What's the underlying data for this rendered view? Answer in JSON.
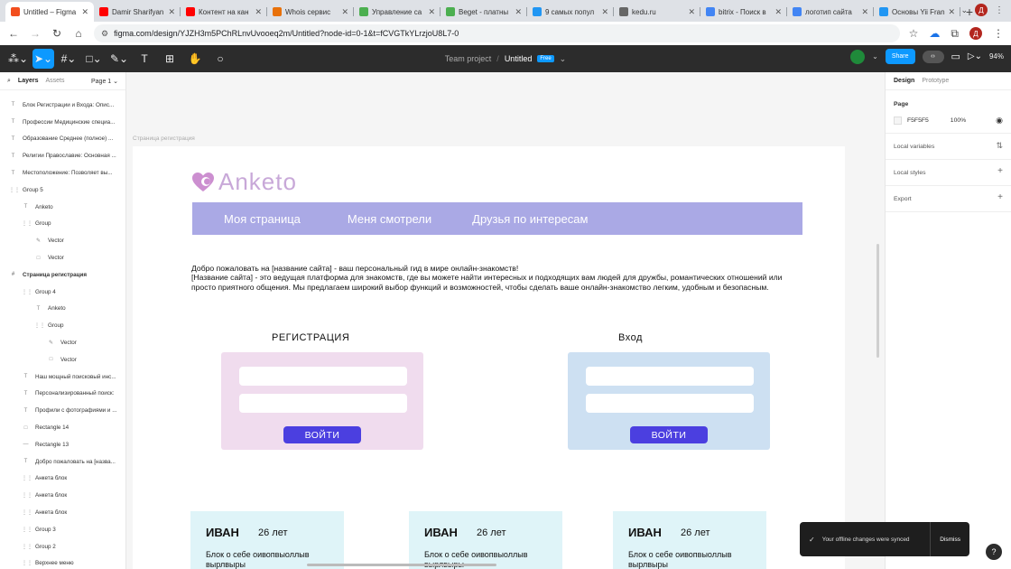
{
  "browser": {
    "tabs": [
      {
        "label": "Untitled – Figma",
        "color": "#f24e1e",
        "active": true
      },
      {
        "label": "Damir Sharifyan",
        "color": "#ff0000"
      },
      {
        "label": "Контент на кан",
        "color": "#ff0000"
      },
      {
        "label": "Whois сервис",
        "color": "#e8710a"
      },
      {
        "label": "Управление са",
        "color": "#4caf50"
      },
      {
        "label": "Beget - платны",
        "color": "#4caf50"
      },
      {
        "label": "9 самых попул",
        "color": "#2196f3"
      },
      {
        "label": "kedu.ru",
        "color": "#666666"
      },
      {
        "label": "bitrix - Поиск в",
        "color": "#4285f4"
      },
      {
        "label": "логотип сайта",
        "color": "#4285f4"
      },
      {
        "label": "Основы Yii Fran",
        "color": "#2196f3"
      }
    ],
    "new_tab": "+",
    "profile_initial": "Д",
    "url": "figma.com/design/YJZH3m5PChRLnvUvooeq2m/Untitled?node-id=0-1&t=fCVGTkYLrzjoU8L7-0"
  },
  "figma_toolbar": {
    "project": "Team project",
    "separator": "/",
    "file": "Untitled",
    "plan_badge": "Free",
    "share": "Share",
    "zoom": "94%"
  },
  "left_panel": {
    "tab_layers": "Layers",
    "tab_assets": "Assets",
    "page": "Page 1",
    "layers": [
      {
        "icon": "T",
        "name": "Блок Регистрации и Входа: Опис...",
        "indent": 0
      },
      {
        "icon": "T",
        "name": "Профессии Медицинские специа...",
        "indent": 0
      },
      {
        "icon": "T",
        "name": "Образование Среднее (полное) ...",
        "indent": 0
      },
      {
        "icon": "T",
        "name": "Религии Православие: Основная ...",
        "indent": 0
      },
      {
        "icon": "T",
        "name": "Местоположение: Позволяет вы...",
        "indent": 0
      },
      {
        "icon": "⋮⋮",
        "name": "Group 5",
        "indent": 0
      },
      {
        "icon": "T",
        "name": "Anketo",
        "indent": 1
      },
      {
        "icon": "⋮⋮",
        "name": "Group",
        "indent": 1
      },
      {
        "icon": "✎",
        "name": "Vector",
        "indent": 2
      },
      {
        "icon": "□",
        "name": "Vector",
        "indent": 2
      },
      {
        "icon": "#",
        "name": "Страница регистрация",
        "indent": 0,
        "bold": true
      },
      {
        "icon": "⋮⋮",
        "name": "Group 4",
        "indent": 1
      },
      {
        "icon": "T",
        "name": "Anketo",
        "indent": 2
      },
      {
        "icon": "⋮⋮",
        "name": "Group",
        "indent": 2
      },
      {
        "icon": "✎",
        "name": "Vector",
        "indent": 3
      },
      {
        "icon": "□",
        "name": "Vector",
        "indent": 3
      },
      {
        "icon": "T",
        "name": "Наш мощный поисковый инс...",
        "indent": 1
      },
      {
        "icon": "T",
        "name": "Персонализированный поиск:",
        "indent": 1
      },
      {
        "icon": "T",
        "name": "Профили с фотографиями и ...",
        "indent": 1
      },
      {
        "icon": "□",
        "name": "Rectangle 14",
        "indent": 1
      },
      {
        "icon": "—",
        "name": "Rectangle 13",
        "indent": 1
      },
      {
        "icon": "T",
        "name": "Добро пожаловать на [назва...",
        "indent": 1
      },
      {
        "icon": "⋮⋮",
        "name": "Анкета блок",
        "indent": 1
      },
      {
        "icon": "⋮⋮",
        "name": "Анкета блок",
        "indent": 1
      },
      {
        "icon": "⋮⋮",
        "name": "Анкета блок",
        "indent": 1
      },
      {
        "icon": "⋮⋮",
        "name": "Group 3",
        "indent": 1
      },
      {
        "icon": "⋮⋮",
        "name": "Group 2",
        "indent": 1
      },
      {
        "icon": "⋮⋮",
        "name": "Верхнее меню",
        "indent": 1
      }
    ]
  },
  "canvas": {
    "frame_label": "Страница регистрация",
    "logo_text": "Anketo",
    "nav": [
      "Моя страница",
      "Меня смотрели",
      "Друзья по интересам"
    ],
    "intro_line1": "Добро пожаловать на [название сайта] - ваш персональный гид в мире онлайн-знакомств!",
    "intro_line2": "[Название сайта] - это ведущая платформа для знакомств, где вы можете найти интересных и подходящих вам людей для дружбы, романтических отношений или просто приятного общения. Мы предлагаем широкий выбор функций и возможностей, чтобы сделать ваше онлайн-знакомство легким, удобным и безопасным.",
    "register": {
      "title": "РЕГИСТРАЦИЯ",
      "button": "ВОЙТИ",
      "color": "#f0dcee"
    },
    "login": {
      "title": "Вход",
      "button": "ВОЙТИ",
      "color": "#cde0f2"
    },
    "cards": [
      {
        "name": "ИВАН",
        "age": "26 лет",
        "desc": "Блок о себе оивопвыоллыв вырлвыры"
      },
      {
        "name": "ИВАН",
        "age": "26 лет",
        "desc": "Блок о себе оивопвыоллыв вырлвыры"
      },
      {
        "name": "ИВАН",
        "age": "26 лет",
        "desc": "Блок о себе оивопвыоллыв вырлвыры"
      }
    ],
    "nav_color": "#aaa9e5",
    "button_color": "#4b3fe0"
  },
  "right_panel": {
    "tab_design": "Design",
    "tab_prototype": "Prototype",
    "page_title": "Page",
    "page_color": "F5F5F5",
    "page_opacity": "100%",
    "local_variables": "Local variables",
    "local_styles": "Local styles",
    "export": "Export"
  },
  "toast": {
    "message": "Your offline changes were synced",
    "dismiss": "Dismiss"
  },
  "help": "?"
}
